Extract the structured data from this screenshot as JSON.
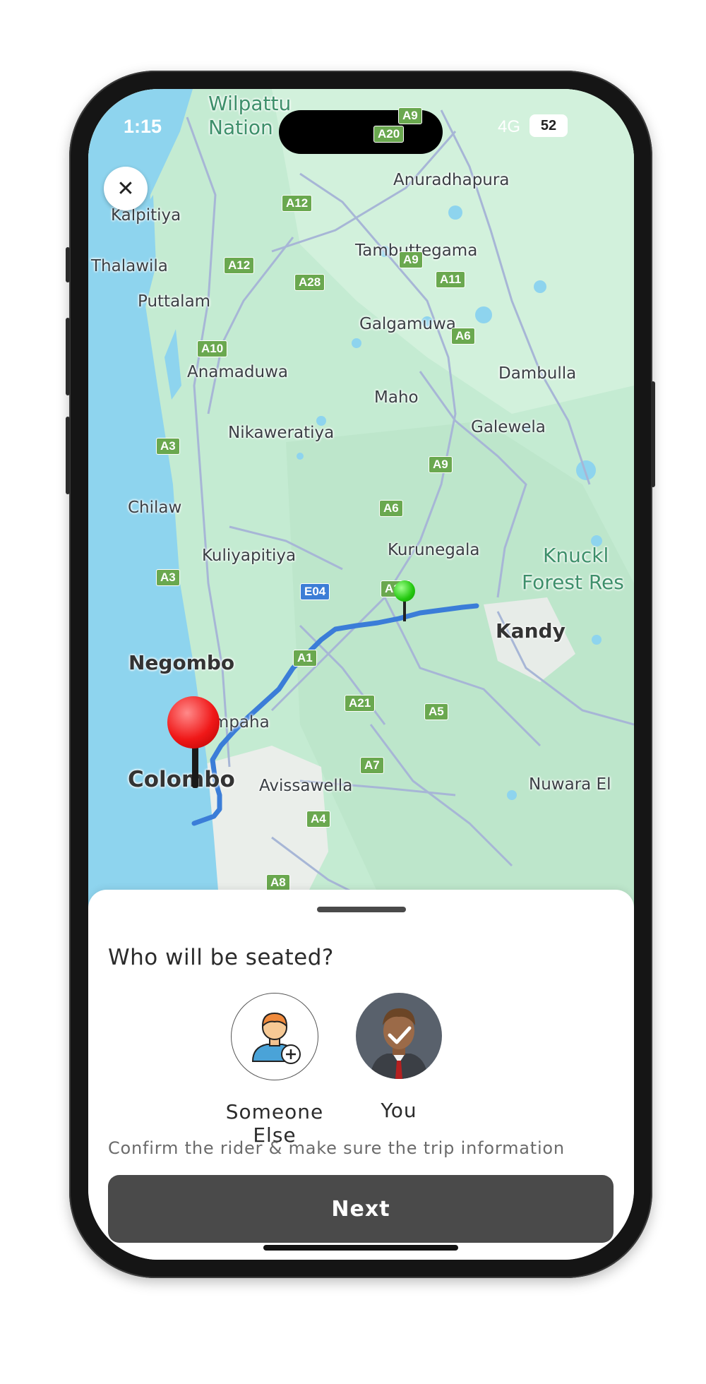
{
  "status_bar": {
    "time": "1:15",
    "network": "4G",
    "battery": "52"
  },
  "map": {
    "places": [
      {
        "id": "wilpattu",
        "text": "Wilpattu"
      },
      {
        "id": "nation",
        "text": "Nation"
      },
      {
        "id": "anuradhapura",
        "text": "Anuradhapura"
      },
      {
        "id": "kalpitiya",
        "text": "Kalpitiya"
      },
      {
        "id": "thalawila",
        "text": "Thalawila"
      },
      {
        "id": "tambuttegama",
        "text": "Tambuttegama"
      },
      {
        "id": "puttalam",
        "text": "Puttalam"
      },
      {
        "id": "galgamuwa",
        "text": "Galgamuwa"
      },
      {
        "id": "anamaduwa",
        "text": "Anamaduwa"
      },
      {
        "id": "dambulla",
        "text": "Dambulla"
      },
      {
        "id": "maho",
        "text": "Maho"
      },
      {
        "id": "nikaweratiya",
        "text": "Nikaweratiya"
      },
      {
        "id": "galewela",
        "text": "Galewela"
      },
      {
        "id": "chilaw",
        "text": "Chilaw"
      },
      {
        "id": "kuliyapitiya",
        "text": "Kuliyapitiya"
      },
      {
        "id": "kurunegala",
        "text": "Kurunegala"
      },
      {
        "id": "knuckles",
        "text": "Knuckl"
      },
      {
        "id": "forest",
        "text": "Forest Res"
      },
      {
        "id": "kandy",
        "text": "Kandy"
      },
      {
        "id": "negombo",
        "text": "Negombo"
      },
      {
        "id": "gampaha",
        "text": "Gampaha"
      },
      {
        "id": "colombo",
        "text": "Colombo"
      },
      {
        "id": "avissawella",
        "text": "Avissawella"
      },
      {
        "id": "nuwara",
        "text": "Nuwara El"
      }
    ],
    "road_shields": [
      "A9",
      "A20",
      "A12",
      "A12",
      "A9",
      "A28",
      "A11",
      "A10",
      "A6",
      "A3",
      "A9",
      "A6",
      "A3",
      "A10",
      "E04",
      "A1",
      "A21",
      "A5",
      "A7",
      "A4",
      "A8"
    ]
  },
  "sheet": {
    "title": "Who will be seated?",
    "options": [
      {
        "label": "Someone Else"
      },
      {
        "label": "You"
      }
    ],
    "hint": "Confirm the rider & make sure the trip information",
    "next_label": "Next"
  }
}
